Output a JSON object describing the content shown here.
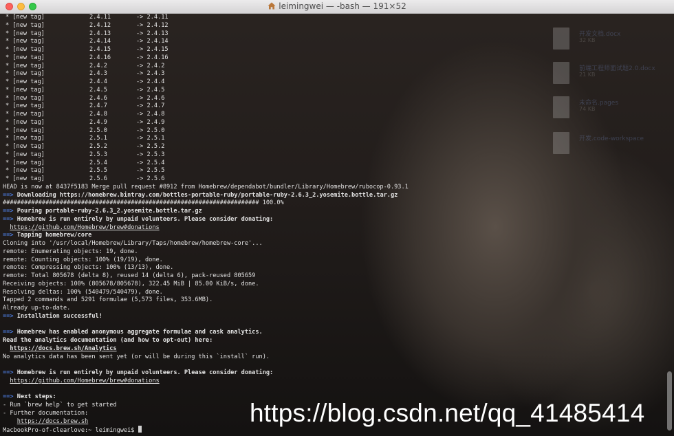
{
  "window": {
    "title": "leimingwei — -bash — 191×52"
  },
  "terminal": {
    "tags": [
      {
        "label": "* [new tag]",
        "ver": "2.4.11",
        "target": "-> 2.4.11"
      },
      {
        "label": "* [new tag]",
        "ver": "2.4.12",
        "target": "-> 2.4.12"
      },
      {
        "label": "* [new tag]",
        "ver": "2.4.13",
        "target": "-> 2.4.13"
      },
      {
        "label": "* [new tag]",
        "ver": "2.4.14",
        "target": "-> 2.4.14"
      },
      {
        "label": "* [new tag]",
        "ver": "2.4.15",
        "target": "-> 2.4.15"
      },
      {
        "label": "* [new tag]",
        "ver": "2.4.16",
        "target": "-> 2.4.16"
      },
      {
        "label": "* [new tag]",
        "ver": "2.4.2",
        "target": "-> 2.4.2"
      },
      {
        "label": "* [new tag]",
        "ver": "2.4.3",
        "target": "-> 2.4.3"
      },
      {
        "label": "* [new tag]",
        "ver": "2.4.4",
        "target": "-> 2.4.4"
      },
      {
        "label": "* [new tag]",
        "ver": "2.4.5",
        "target": "-> 2.4.5"
      },
      {
        "label": "* [new tag]",
        "ver": "2.4.6",
        "target": "-> 2.4.6"
      },
      {
        "label": "* [new tag]",
        "ver": "2.4.7",
        "target": "-> 2.4.7"
      },
      {
        "label": "* [new tag]",
        "ver": "2.4.8",
        "target": "-> 2.4.8"
      },
      {
        "label": "* [new tag]",
        "ver": "2.4.9",
        "target": "-> 2.4.9"
      },
      {
        "label": "* [new tag]",
        "ver": "2.5.0",
        "target": "-> 2.5.0"
      },
      {
        "label": "* [new tag]",
        "ver": "2.5.1",
        "target": "-> 2.5.1"
      },
      {
        "label": "* [new tag]",
        "ver": "2.5.2",
        "target": "-> 2.5.2"
      },
      {
        "label": "* [new tag]",
        "ver": "2.5.3",
        "target": "-> 2.5.3"
      },
      {
        "label": "* [new tag]",
        "ver": "2.5.4",
        "target": "-> 2.5.4"
      },
      {
        "label": "* [new tag]",
        "ver": "2.5.5",
        "target": "-> 2.5.5"
      },
      {
        "label": "* [new tag]",
        "ver": "2.5.6",
        "target": "-> 2.5.6"
      }
    ],
    "lines": [
      {
        "text": "HEAD is now at 8437f5183 Merge pull request #8912 from Homebrew/dependabot/bundler/Library/Homebrew/rubocop-0.93.1"
      },
      {
        "arrow": "==>",
        "text": " Downloading https://homebrew.bintray.com/bottles-portable-ruby/portable-ruby-2.6.3_2.yosemite.bottle.tar.gz",
        "bold": true
      },
      {
        "text": "######################################################################## 100.0%"
      },
      {
        "arrow": "==>",
        "text": " Pouring portable-ruby-2.6.3_2.yosemite.bottle.tar.gz",
        "bold": true
      },
      {
        "arrow": "==>",
        "text": " Homebrew is run entirely by unpaid volunteers. Please consider donating:",
        "bold": true
      },
      {
        "text": "https://github.com/Homebrew/brew#donations",
        "indent": "  ",
        "underline": true
      },
      {
        "arrow": "==>",
        "text": " Tapping homebrew/core",
        "bold": true
      },
      {
        "text": "Cloning into '/usr/local/Homebrew/Library/Taps/homebrew/homebrew-core'..."
      },
      {
        "text": "remote: Enumerating objects: 19, done."
      },
      {
        "text": "remote: Counting objects: 100% (19/19), done."
      },
      {
        "text": "remote: Compressing objects: 100% (13/13), done."
      },
      {
        "text": "remote: Total 805678 (delta 8), reused 14 (delta 6), pack-reused 805659"
      },
      {
        "text": "Receiving objects: 100% (805678/805678), 322.45 MiB | 85.00 KiB/s, done."
      },
      {
        "text": "Resolving deltas: 100% (540479/540479), done."
      },
      {
        "text": "Tapped 2 commands and 5291 formulae (5,573 files, 353.6MB)."
      },
      {
        "text": "Already up-to-date."
      },
      {
        "arrow": "==>",
        "text": " Installation successful!",
        "bold": true
      },
      {
        "text": ""
      },
      {
        "arrow": "==>",
        "text": " Homebrew has enabled anonymous aggregate formulae and cask analytics.",
        "bold": true
      },
      {
        "text": "Read the analytics documentation (and how to opt-out) here:",
        "bold": true
      },
      {
        "text": "https://docs.brew.sh/Analytics",
        "indent": "  ",
        "underline": true,
        "bold": true
      },
      {
        "text": "No analytics data has been sent yet (or will be during this `install` run)."
      },
      {
        "text": ""
      },
      {
        "arrow": "==>",
        "text": " Homebrew is run entirely by unpaid volunteers. Please consider donating:",
        "bold": true
      },
      {
        "text": "https://github.com/Homebrew/brew#donations",
        "indent": "  ",
        "underline": true
      },
      {
        "text": ""
      },
      {
        "arrow": "==>",
        "text": " Next steps:",
        "bold": true
      },
      {
        "text": "- Run `brew help` to get started"
      },
      {
        "text": "- Further documentation:"
      },
      {
        "text": "https://docs.brew.sh",
        "indent": "    ",
        "underline": true
      }
    ],
    "prompt": "MacbookPro-of-clearlove:~ leimingwei$ "
  },
  "desktop_items": [
    {
      "name": "开发文档.docx",
      "size": "32 KB"
    },
    {
      "name": "前端工程师面试题2.0.docx",
      "size": "21 KB"
    },
    {
      "name": "未命名.pages",
      "size": "74 KB"
    },
    {
      "name": "开发.code-workspace",
      "size": ""
    }
  ],
  "watermark": "https://blog.csdn.net/qq_41485414"
}
